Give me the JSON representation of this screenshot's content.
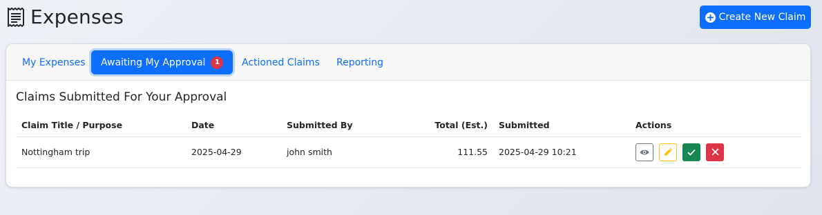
{
  "header": {
    "title": "Expenses",
    "create_button_label": "Create New Claim"
  },
  "tabs": [
    {
      "label": "My Expenses",
      "active": false
    },
    {
      "label": "Awaiting My Approval",
      "active": true,
      "badge": "1"
    },
    {
      "label": "Actioned Claims",
      "active": false
    },
    {
      "label": "Reporting",
      "active": false
    }
  ],
  "section": {
    "title": "Claims Submitted For Your Approval"
  },
  "table": {
    "columns": [
      "Claim Title / Purpose",
      "Date",
      "Submitted By",
      "Total (Est.)",
      "Submitted",
      "Actions"
    ],
    "rows": [
      {
        "title": "Nottingham trip",
        "date": "2025-04-29",
        "submitted_by": "john smith",
        "total": "111.55",
        "submitted": "2025-04-29 10:21",
        "actions": [
          "eye-icon",
          "pencil-icon",
          "check-icon",
          "x-icon"
        ]
      }
    ]
  },
  "colors": {
    "primary": "#0d6efd",
    "danger": "#dc3545",
    "success": "#198754",
    "warning": "#ffc107",
    "secondary": "#6c757d"
  }
}
